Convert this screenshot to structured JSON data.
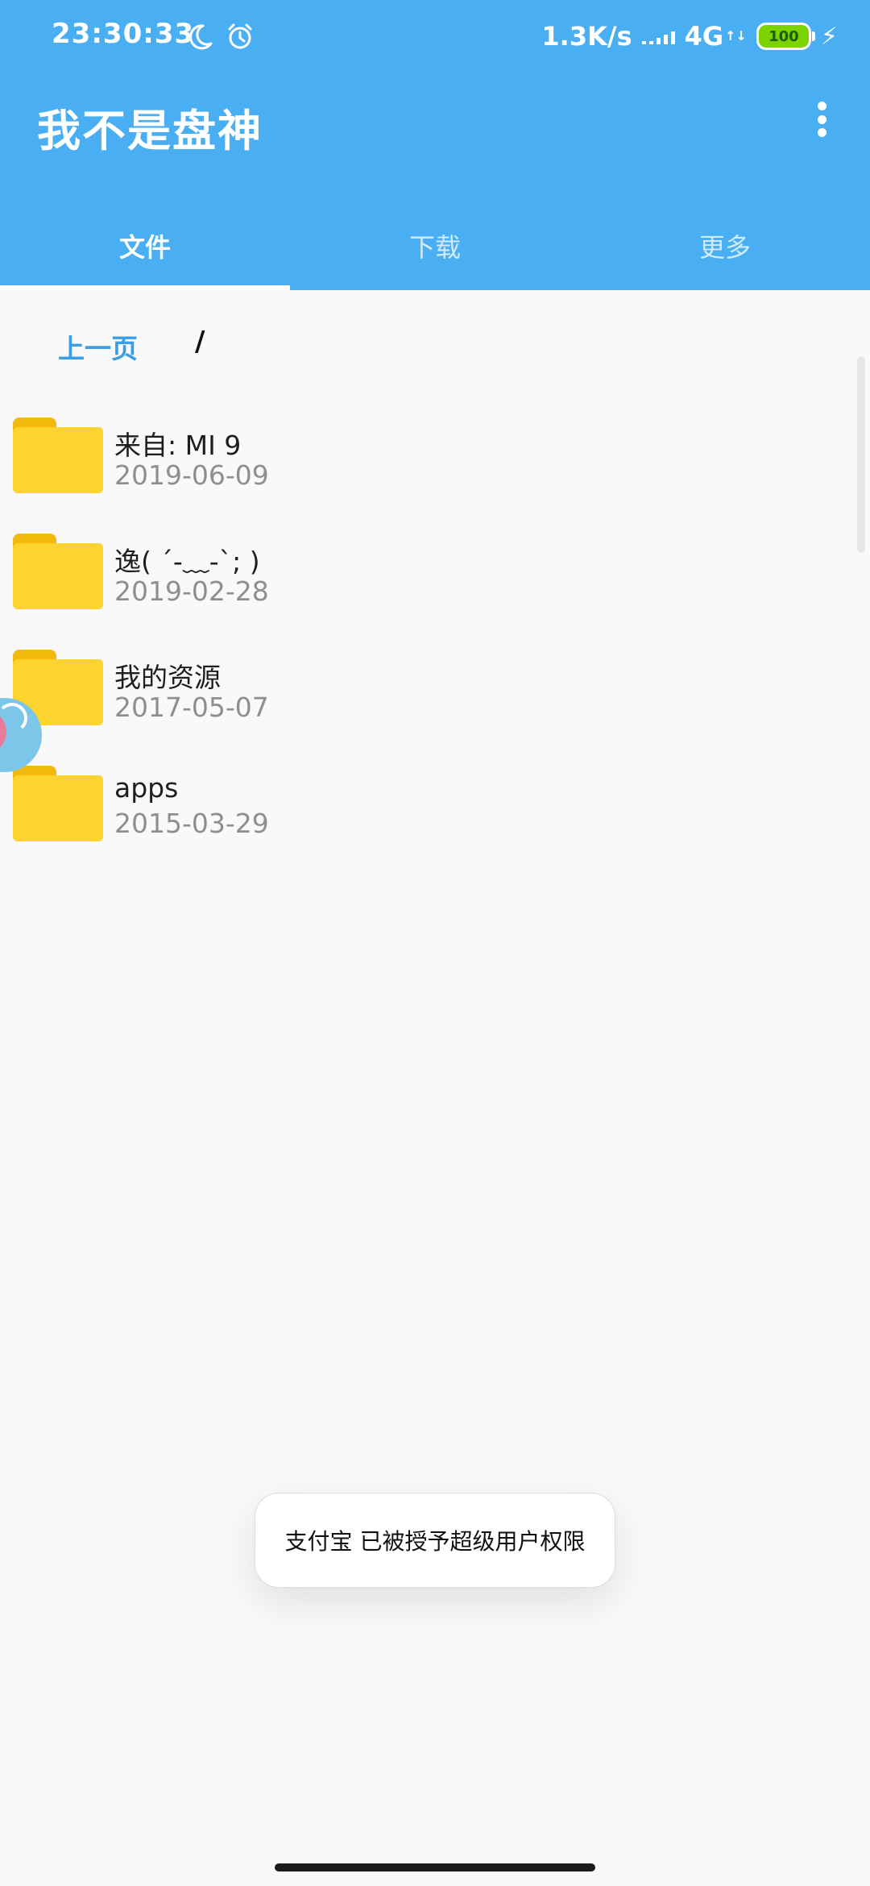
{
  "status_bar": {
    "time": "23:30:33",
    "net_speed": "1.3K/s",
    "network_type": "4G",
    "network_arrows": "↑↓",
    "battery": "100",
    "icons": [
      "moon-icon",
      "alarm-icon",
      "signal-icon",
      "charging-icon"
    ]
  },
  "app": {
    "title": "我不是盘神",
    "menu_icon": "more-vert-icon"
  },
  "tabs": [
    {
      "label": "文件",
      "active": true
    },
    {
      "label": "下载",
      "active": false
    },
    {
      "label": "更多",
      "active": false
    }
  ],
  "path_bar": {
    "back_label": "上一页",
    "current_path": "/"
  },
  "files": [
    {
      "name": "来自: MI 9",
      "date": "2019-06-09",
      "icon": "folder-icon"
    },
    {
      "name": "逸( ´-﹏-`; )",
      "date": "2019-02-28",
      "icon": "folder-icon"
    },
    {
      "name": "我的资源",
      "date": "2017-05-07",
      "icon": "folder-icon"
    },
    {
      "name": "apps",
      "date": "2015-03-29",
      "icon": "folder-icon"
    }
  ],
  "toast": {
    "message": "支付宝 已被授予超级用户权限"
  },
  "colors": {
    "header": "#4aaef2",
    "accent": "#3a9de8",
    "folder": "#fdd330",
    "background": "#f9f9f9"
  }
}
